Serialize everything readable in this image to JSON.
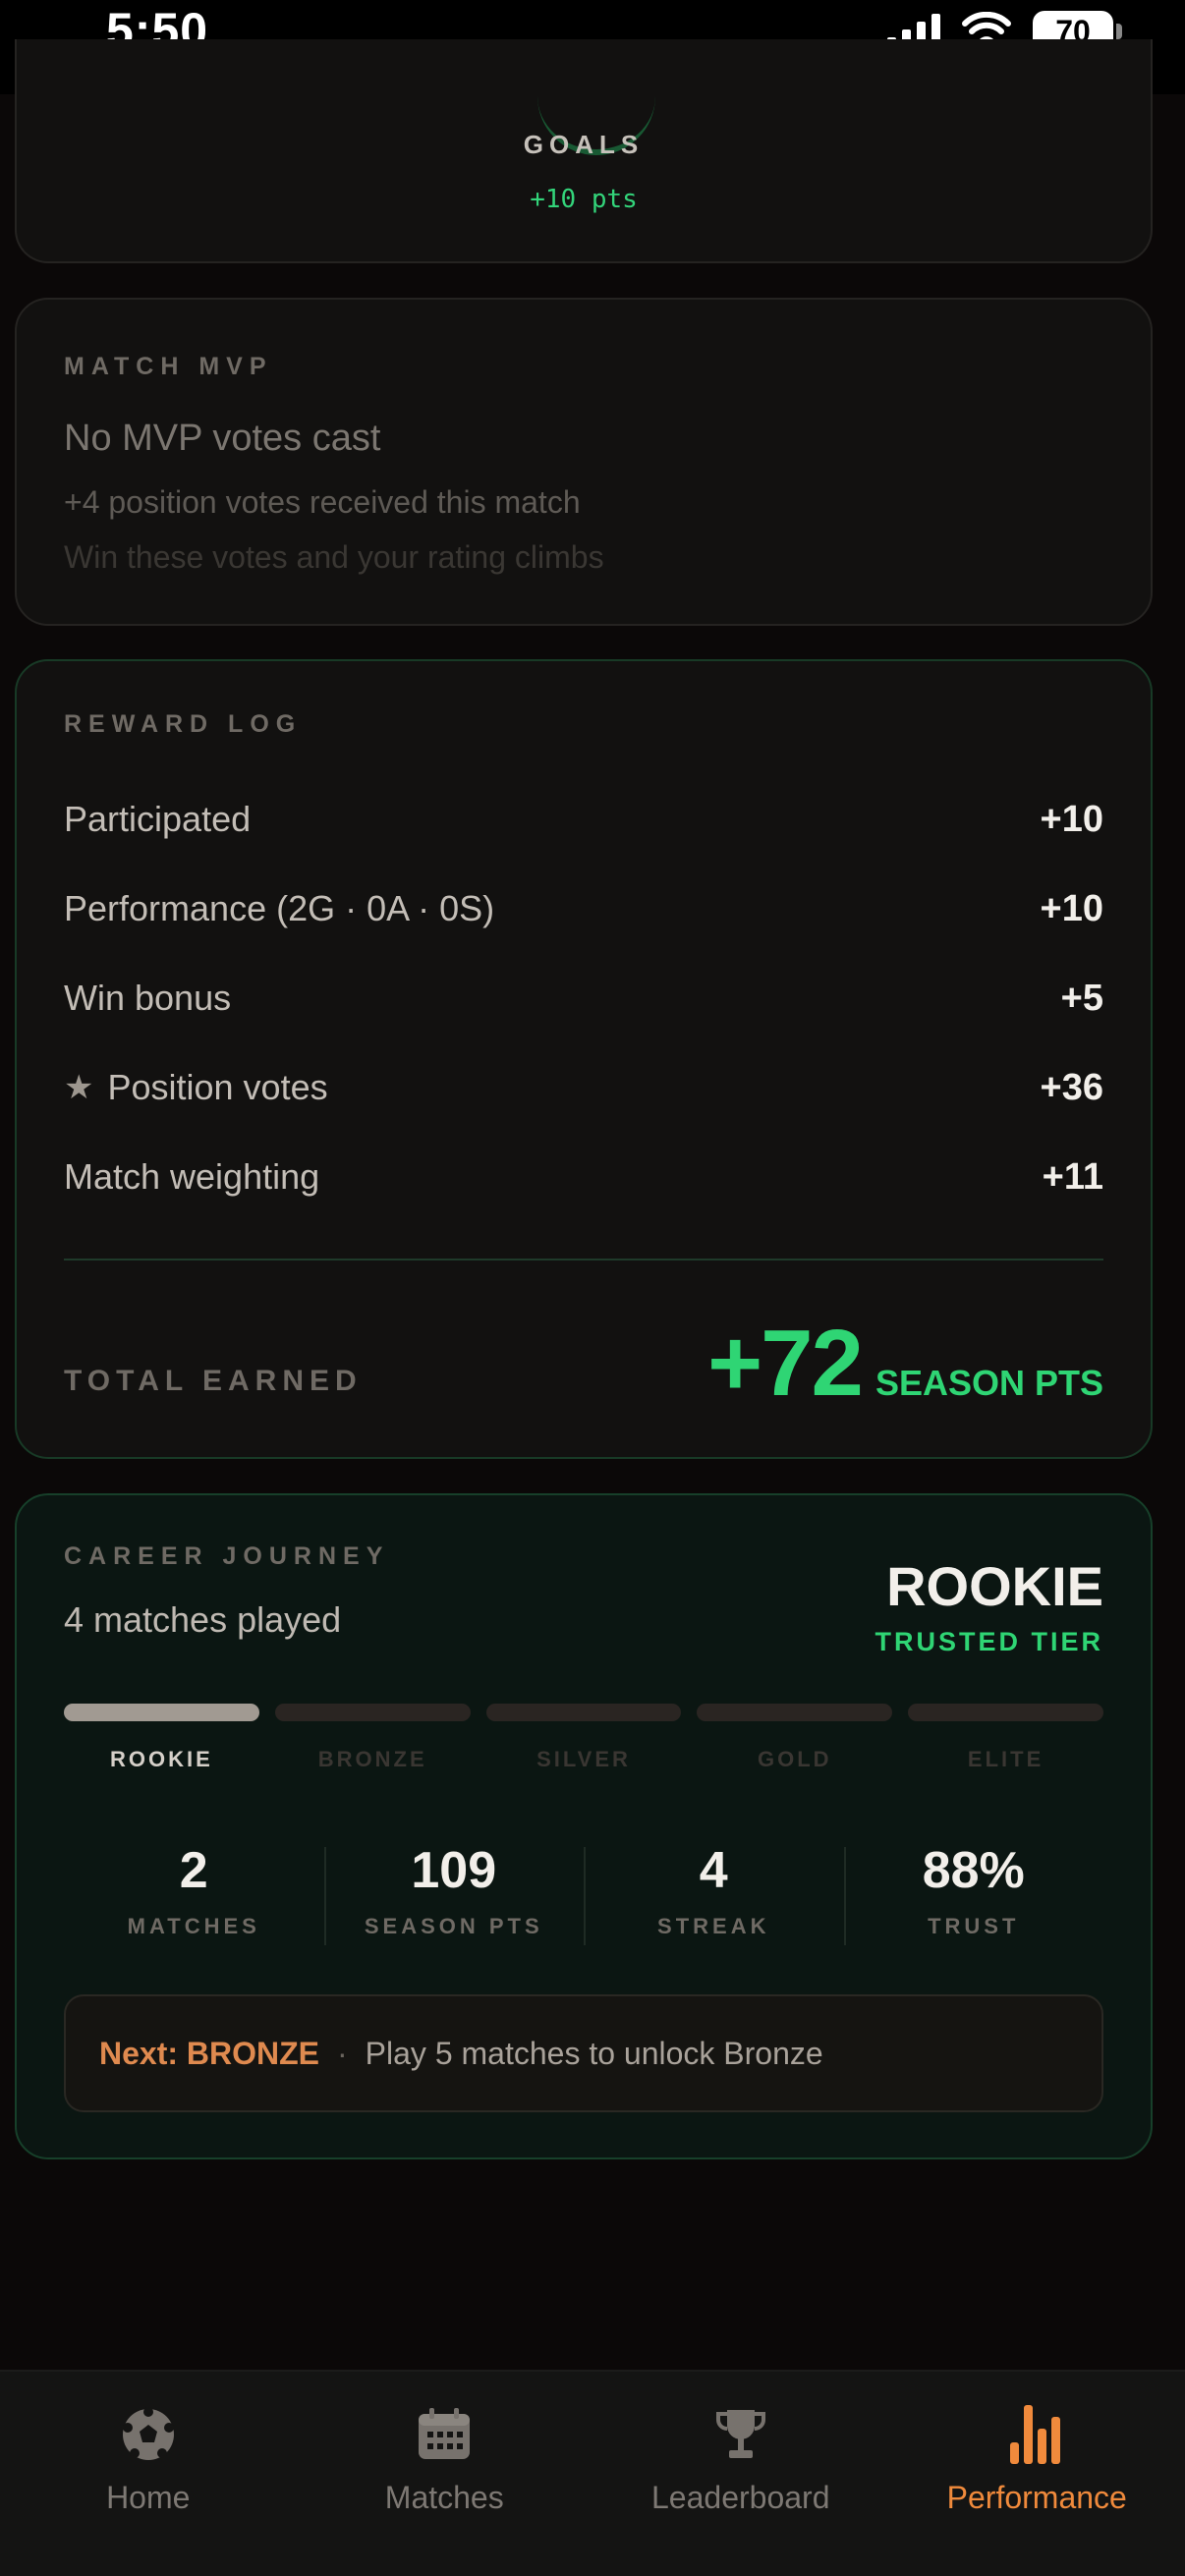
{
  "status_bar": {
    "time": "5:50",
    "battery": "70"
  },
  "goals_card": {
    "label": "GOALS",
    "points": "+10 pts"
  },
  "mvp_card": {
    "label": "MATCH MVP",
    "title": "No MVP votes cast",
    "subtitle": "+4 position votes received this match",
    "hint": "Win these votes and your rating climbs"
  },
  "reward_log": {
    "label": "REWARD LOG",
    "rows": [
      {
        "label": "Participated",
        "value": "+10"
      },
      {
        "label": "Performance  (2G · 0A · 0S)",
        "value": "+10"
      },
      {
        "label": "Win bonus",
        "value": "+5"
      },
      {
        "label": "Position votes",
        "value": "+36",
        "icon": "star-icon"
      },
      {
        "label": "Match weighting",
        "value": "+11"
      }
    ],
    "total_label": "TOTAL EARNED",
    "total_value": "+72",
    "total_unit": "SEASON PTS",
    "accent_color": "#2fd574"
  },
  "career": {
    "label": "CAREER JOURNEY",
    "matches_played": "4 matches played",
    "tier": "ROOKIE",
    "tier_sub": "TRUSTED TIER",
    "tiers": [
      "ROOKIE",
      "BRONZE",
      "SILVER",
      "GOLD",
      "ELITE"
    ],
    "current_tier_index": 0,
    "stats": [
      {
        "value": "2",
        "label": "MATCHES"
      },
      {
        "value": "109",
        "label": "SEASON PTS"
      },
      {
        "value": "4",
        "label": "STREAK"
      },
      {
        "value": "88%",
        "label": "TRUST"
      }
    ],
    "next": {
      "label": "Next: BRONZE",
      "separator": "·",
      "text": "Play 5 matches to unlock Bronze",
      "color": "#df8a4f"
    }
  },
  "bottom_nav": {
    "items": [
      {
        "label": "Home",
        "icon": "soccer-ball-icon"
      },
      {
        "label": "Matches",
        "icon": "calendar-icon"
      },
      {
        "label": "Leaderboard",
        "icon": "trophy-icon"
      },
      {
        "label": "Performance",
        "icon": "bar-chart-icon",
        "active": true
      }
    ],
    "active_color": "#f08a3c"
  }
}
